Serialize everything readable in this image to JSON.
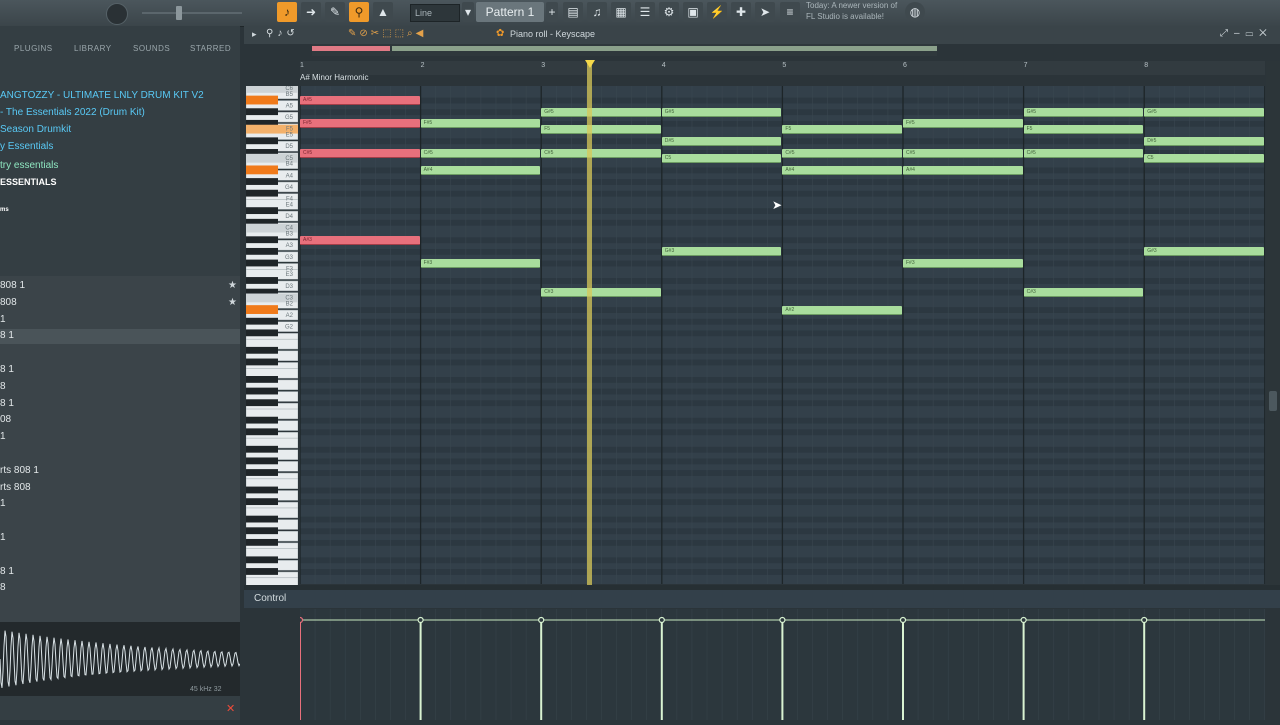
{
  "toolbar": {
    "snap_mode": "Line",
    "pattern_label": "Pattern 1",
    "hint_today": "Today:",
    "hint_message": "A newer version of FL Studio is available!"
  },
  "browser": {
    "tabs": [
      "PLUGINS",
      "LIBRARY",
      "SOUNDS",
      "STARRED"
    ],
    "folders": [
      {
        "label": "ANGTOZZY - ULTIMATE LNLY DRUM KIT V2",
        "style": "blue"
      },
      {
        "label": "- The Essentials 2022 (Drum Kit)",
        "style": "blue"
      },
      {
        "label": "Season Drumkit",
        "style": "blue"
      },
      {
        "label": "y Essentials",
        "style": "blue"
      },
      {
        "label": "try essentials",
        "style": "green"
      },
      {
        "label": "ESSENTIALS",
        "style": "white"
      },
      {
        "label": "ms",
        "style": "white"
      }
    ],
    "sounds": [
      "808  1",
      "808",
      "1",
      "8  1",
      "",
      "8  1",
      "8",
      "8  1",
      "08",
      "1",
      "",
      "rts 808  1",
      "rts 808",
      "1",
      "",
      "1",
      "",
      "8  1",
      "8"
    ],
    "starred_rows": [
      0,
      1
    ],
    "selected_row": 3,
    "wave_info": "45 kHz 32"
  },
  "piano_roll": {
    "title": "Piano roll - Keyscape",
    "scale": "A# Minor Harmonic",
    "ruler": [
      "1",
      "2",
      "3",
      "4",
      "5",
      "6",
      "7",
      "8"
    ],
    "keys": [
      {
        "label": "C6",
        "octave_c": true
      },
      {
        "label": "B5"
      },
      {
        "label": "A5"
      },
      {
        "label": "G5"
      },
      {
        "label": "F5",
        "highlight": true
      },
      {
        "label": "E5"
      },
      {
        "label": "D5"
      },
      {
        "label": "C5",
        "octave_c": true
      },
      {
        "label": "B4"
      },
      {
        "label": "A4"
      },
      {
        "label": "G4"
      },
      {
        "label": "F4"
      },
      {
        "label": "E4"
      },
      {
        "label": "D4"
      },
      {
        "label": "C4",
        "octave_c": true
      },
      {
        "label": "B3"
      },
      {
        "label": "A3"
      },
      {
        "label": "G3"
      },
      {
        "label": "F3"
      },
      {
        "label": "E3"
      },
      {
        "label": "D3"
      },
      {
        "label": "C3",
        "octave_c": true
      },
      {
        "label": "B2"
      },
      {
        "label": "A2"
      },
      {
        "label": "G2"
      }
    ],
    "notes": [
      {
        "pitch": "A#5",
        "bar": 1,
        "len": 1,
        "selected": true
      },
      {
        "pitch": "F#5",
        "bar": 1,
        "len": 1,
        "selected": true
      },
      {
        "pitch": "C#5",
        "bar": 1,
        "len": 1,
        "selected": true
      },
      {
        "pitch": "A#3",
        "bar": 1,
        "len": 1,
        "selected": true
      },
      {
        "pitch": "F#5",
        "bar": 2,
        "len": 1
      },
      {
        "pitch": "C#5",
        "bar": 2,
        "len": 1
      },
      {
        "pitch": "A#4",
        "bar": 2,
        "len": 1
      },
      {
        "pitch": "F#3",
        "bar": 2,
        "len": 1
      },
      {
        "pitch": "G#5",
        "bar": 3,
        "len": 1
      },
      {
        "pitch": "F5",
        "bar": 3,
        "len": 1
      },
      {
        "pitch": "C#5",
        "bar": 3,
        "len": 1
      },
      {
        "pitch": "C#3",
        "bar": 3,
        "len": 1
      },
      {
        "pitch": "G#5",
        "bar": 4,
        "len": 1
      },
      {
        "pitch": "D#5",
        "bar": 4,
        "len": 1
      },
      {
        "pitch": "C5",
        "bar": 4,
        "len": 1
      },
      {
        "pitch": "G#3",
        "bar": 4,
        "len": 1
      },
      {
        "pitch": "F5",
        "bar": 5,
        "len": 1
      },
      {
        "pitch": "C#5",
        "bar": 5,
        "len": 1
      },
      {
        "pitch": "A#4",
        "bar": 5,
        "len": 1
      },
      {
        "pitch": "A#2",
        "bar": 5,
        "len": 1
      },
      {
        "pitch": "F#5",
        "bar": 6,
        "len": 1
      },
      {
        "pitch": "C#5",
        "bar": 6,
        "len": 1
      },
      {
        "pitch": "A#4",
        "bar": 6,
        "len": 1
      },
      {
        "pitch": "F#3",
        "bar": 6,
        "len": 1
      },
      {
        "pitch": "G#5",
        "bar": 7,
        "len": 1
      },
      {
        "pitch": "F5",
        "bar": 7,
        "len": 1
      },
      {
        "pitch": "C#5",
        "bar": 7,
        "len": 1
      },
      {
        "pitch": "C#3",
        "bar": 7,
        "len": 1
      },
      {
        "pitch": "G#5",
        "bar": 8,
        "len": 1
      },
      {
        "pitch": "D#5",
        "bar": 8,
        "len": 1
      },
      {
        "pitch": "C5",
        "bar": 8,
        "len": 1
      },
      {
        "pitch": "G#3",
        "bar": 8,
        "len": 1
      }
    ],
    "playhead_bar": 3.38
  },
  "control": {
    "label": "Control",
    "velocity_markers": [
      1,
      2,
      3,
      4,
      5,
      6,
      7,
      8
    ]
  },
  "colors": {
    "accent": "#f09a2a",
    "note": "#a9dd9d",
    "note_selected": "#e8707c",
    "playhead": "#d8c85a"
  }
}
